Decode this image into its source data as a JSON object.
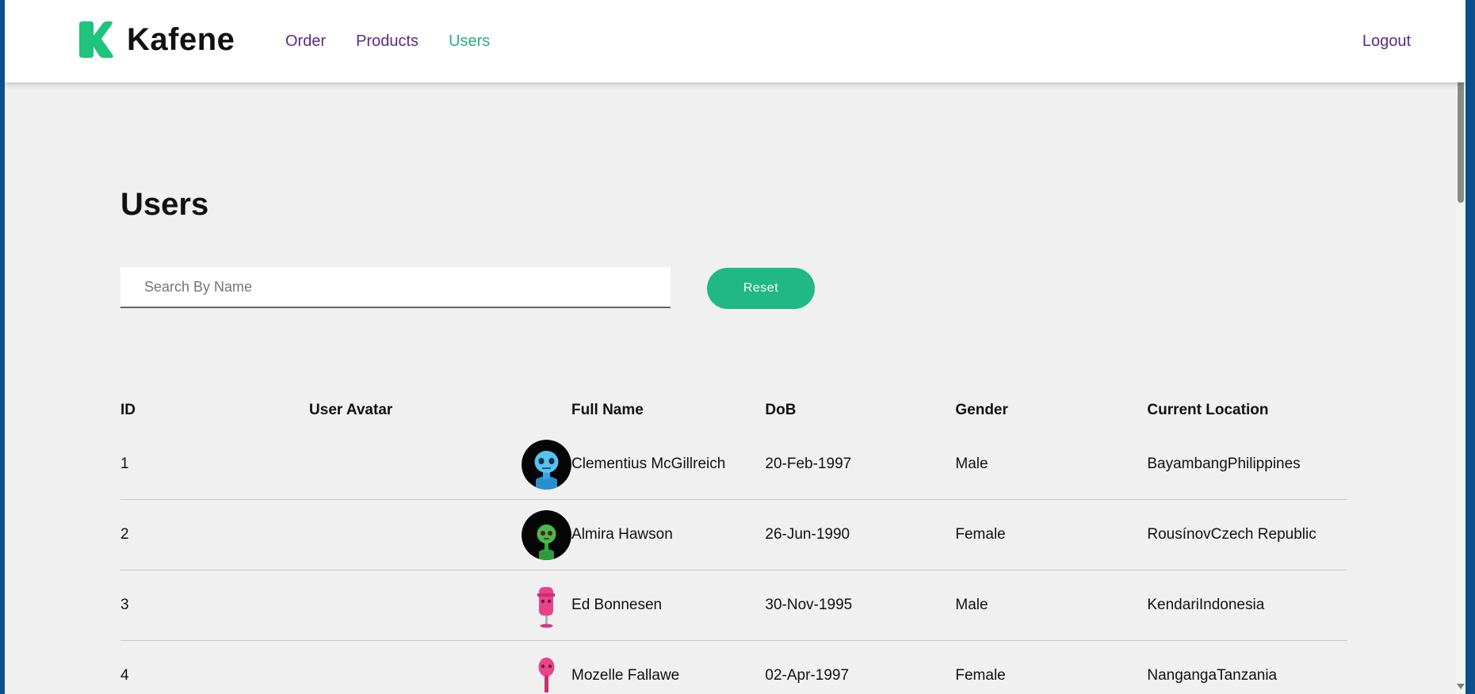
{
  "app": {
    "brand_name": "Kafene",
    "brand_color": "#20c37c"
  },
  "nav": {
    "items": [
      {
        "label": "Order",
        "active": false
      },
      {
        "label": "Products",
        "active": false
      },
      {
        "label": "Users",
        "active": true
      }
    ],
    "logout_label": "Logout",
    "link_color": "#5c2a86",
    "active_color": "#27b07e"
  },
  "main": {
    "title": "Users",
    "search": {
      "placeholder": "Search By Name",
      "value": ""
    },
    "reset_label": "Reset",
    "reset_color": "#20b884"
  },
  "table": {
    "columns": [
      "ID",
      "User Avatar",
      "Full Name",
      "DoB",
      "Gender",
      "Current Location"
    ],
    "rows": [
      {
        "id": "1",
        "avatar": "blue-robot-avatar",
        "name": "Clementius McGillreich",
        "dob": "20-Feb-1997",
        "gender": "Male",
        "location": "BayambangPhilippines"
      },
      {
        "id": "2",
        "avatar": "green-robot-avatar",
        "name": "Almira Hawson",
        "dob": "26-Jun-1990",
        "gender": "Female",
        "location": "RousínovCzech Republic"
      },
      {
        "id": "3",
        "avatar": "pink-robot-avatar",
        "name": "Ed Bonnesen",
        "dob": "30-Nov-1995",
        "gender": "Male",
        "location": "KendariIndonesia"
      },
      {
        "id": "4",
        "avatar": "pink-robot-avatar",
        "name": "Mozelle Fallawe",
        "dob": "02-Apr-1997",
        "gender": "Female",
        "location": "NangangaTanzania"
      }
    ]
  }
}
